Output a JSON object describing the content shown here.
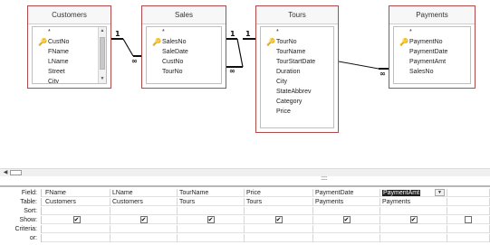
{
  "tables": [
    {
      "name": "Customers",
      "fields": [
        {
          "label": "*",
          "key": false
        },
        {
          "label": "CustNo",
          "key": true
        },
        {
          "label": "FName",
          "key": false
        },
        {
          "label": "LName",
          "key": false
        },
        {
          "label": "Street",
          "key": false
        },
        {
          "label": "City",
          "key": false
        }
      ]
    },
    {
      "name": "Sales",
      "fields": [
        {
          "label": "*",
          "key": false
        },
        {
          "label": "SalesNo",
          "key": true
        },
        {
          "label": "SaleDate",
          "key": false
        },
        {
          "label": "CustNo",
          "key": false
        },
        {
          "label": "TourNo",
          "key": false
        }
      ]
    },
    {
      "name": "Tours",
      "fields": [
        {
          "label": "*",
          "key": false
        },
        {
          "label": "TourNo",
          "key": true
        },
        {
          "label": "TourName",
          "key": false
        },
        {
          "label": "TourStartDate",
          "key": false
        },
        {
          "label": "Duration",
          "key": false
        },
        {
          "label": "City",
          "key": false
        },
        {
          "label": "StateAbbrev",
          "key": false
        },
        {
          "label": "Category",
          "key": false
        },
        {
          "label": "Price",
          "key": false
        }
      ]
    },
    {
      "name": "Payments",
      "fields": [
        {
          "label": "*",
          "key": false
        },
        {
          "label": "PaymentNo",
          "key": true
        },
        {
          "label": "PaymentDate",
          "key": false
        },
        {
          "label": "PaymentAmt",
          "key": false
        },
        {
          "label": "SalesNo",
          "key": false
        }
      ]
    }
  ],
  "relationship_labels": {
    "one": "1",
    "many": "∞"
  },
  "splitter_grip": "::::::::::",
  "grid": {
    "row_labels": [
      "Field:",
      "Table:",
      "Sort:",
      "Show:",
      "Criteria:",
      "or:"
    ],
    "columns": [
      {
        "field": "FName",
        "table": "Customers",
        "show": true
      },
      {
        "field": "LName",
        "table": "Customers",
        "show": true
      },
      {
        "field": "TourName",
        "table": "Tours",
        "show": true
      },
      {
        "field": "Price",
        "table": "Tours",
        "show": true
      },
      {
        "field": "PaymentDate",
        "table": "Payments",
        "show": true
      },
      {
        "field": "PaymentAmt",
        "table": "Payments",
        "show": true,
        "selected": true
      },
      {
        "field": "",
        "table": "",
        "show": false
      }
    ],
    "check_glyph": "✔"
  },
  "colors": {
    "table_border": "#b04a4a",
    "key_icon": "#c89b12",
    "selection": "#1e1e1e"
  }
}
